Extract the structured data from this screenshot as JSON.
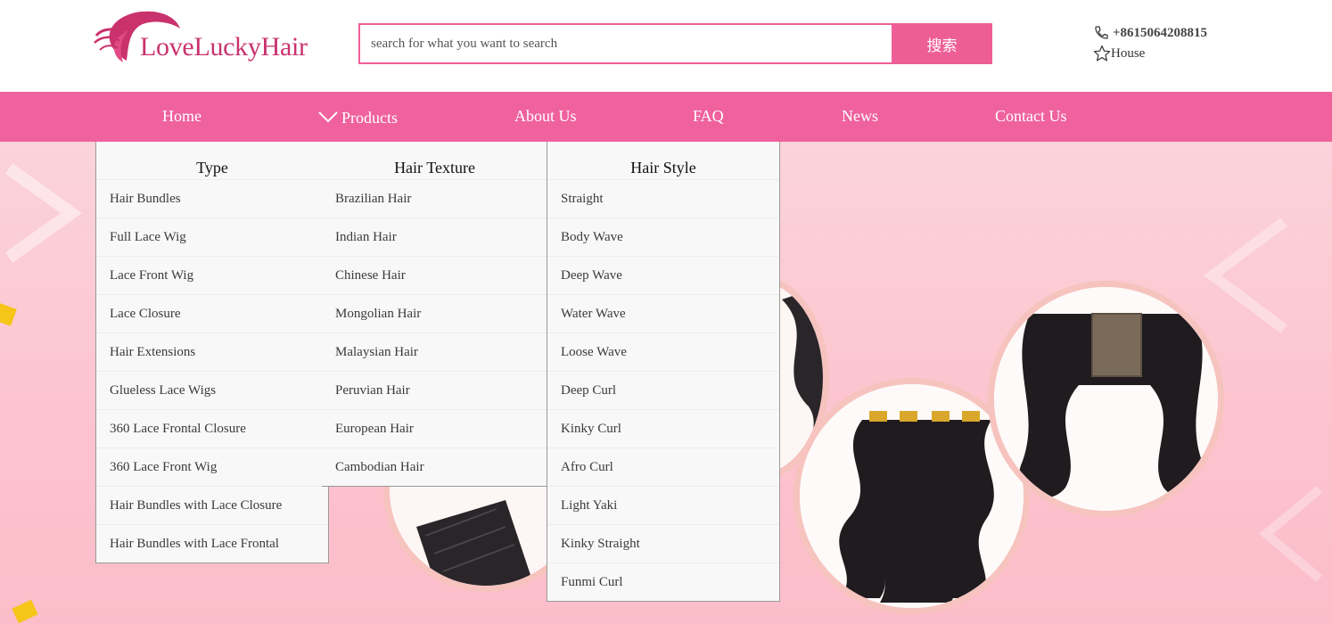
{
  "brand": {
    "logo_text": "LoveLuckyHair"
  },
  "search": {
    "placeholder": "search for what you want to search",
    "button_label": "搜索"
  },
  "contact": {
    "phone": "+8615064208815",
    "favorite_label": "House"
  },
  "nav": {
    "items": [
      {
        "label": "Home"
      },
      {
        "label": "Products"
      },
      {
        "label": "About Us"
      },
      {
        "label": "FAQ"
      },
      {
        "label": "News"
      },
      {
        "label": "Contact Us"
      }
    ]
  },
  "products_menu": {
    "columns": [
      {
        "title": "Type",
        "items": [
          "Hair Bundles",
          "Full Lace Wig",
          "Lace Front Wig",
          "Lace Closure",
          "Hair Extensions",
          "Glueless Lace Wigs",
          "360 Lace Frontal Closure",
          "360 Lace Front Wig",
          "Hair Bundles with Lace Closure",
          "Hair Bundles with Lace Frontal"
        ]
      },
      {
        "title": "Hair Texture",
        "items": [
          "Brazilian Hair",
          "Indian Hair",
          "Chinese Hair",
          "Mongolian Hair",
          "Malaysian Hair",
          "Peruvian Hair",
          "European Hair",
          "Cambodian Hair"
        ]
      },
      {
        "title": "Hair Style",
        "items": [
          "Straight",
          "Body Wave",
          "Deep Wave",
          "Water Wave",
          "Loose Wave",
          "Deep Curl",
          "Kinky Curl",
          "Afro Curl",
          "Light Yaki",
          "Kinky Straight",
          "Funmi Curl"
        ]
      }
    ]
  },
  "colors": {
    "brand_pink": "#ef629e",
    "logo_magenta": "#c9326d",
    "banner_pink": "#fcc3ce"
  },
  "icons": [
    "phone-icon",
    "star-icon",
    "chevron-down-icon",
    "logo-hair-swirl-icon"
  ]
}
